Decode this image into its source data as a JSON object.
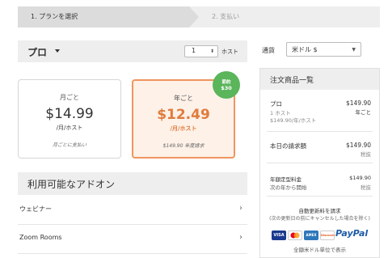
{
  "steps": {
    "step1": "1. プランを選択",
    "step2": "2. 支払い"
  },
  "plan": {
    "name": "プロ",
    "quantity": "1",
    "quantity_unit": "ホスト"
  },
  "pricing": {
    "monthly": {
      "period": "月ごと",
      "price": "$14.99",
      "unit": "/月/ホスト",
      "note": "月ごとに支払い"
    },
    "annual": {
      "period": "年ごと",
      "price": "$12.49",
      "unit": "/月/ホスト",
      "note": "$149.90 年度請求",
      "badge_line1": "節約",
      "badge_line2": "$30"
    }
  },
  "addons": {
    "title": "利用可能なアドオン",
    "items": [
      {
        "label": "ウェビナー"
      },
      {
        "label": "Zoom Rooms"
      }
    ]
  },
  "currency": {
    "label": "通貨",
    "value": "米ドル $"
  },
  "summary": {
    "title": "注文商品一覧",
    "plan_name": "プロ",
    "plan_price": "$149.90",
    "plan_period": "年ごと",
    "plan_hosts": "1 ホスト",
    "plan_rate": "$149.90/年/ホスト",
    "today_label": "本日の請求額",
    "today_price": "$149.90",
    "today_tax": "税抜",
    "fixed_label": "年額定型料金",
    "fixed_sub": "次の年から開始",
    "fixed_price": "$149.90",
    "fixed_tax": "税抜",
    "renew_title": "自動更新料を請求",
    "renew_note": "(次の更新日の前にキャンセルした場合を除く)",
    "footer_note": "全額米ドル単位で表示",
    "payment_brands": [
      "VISA",
      "MasterCard",
      "AMEX",
      "Discover",
      "PayPal"
    ]
  }
}
